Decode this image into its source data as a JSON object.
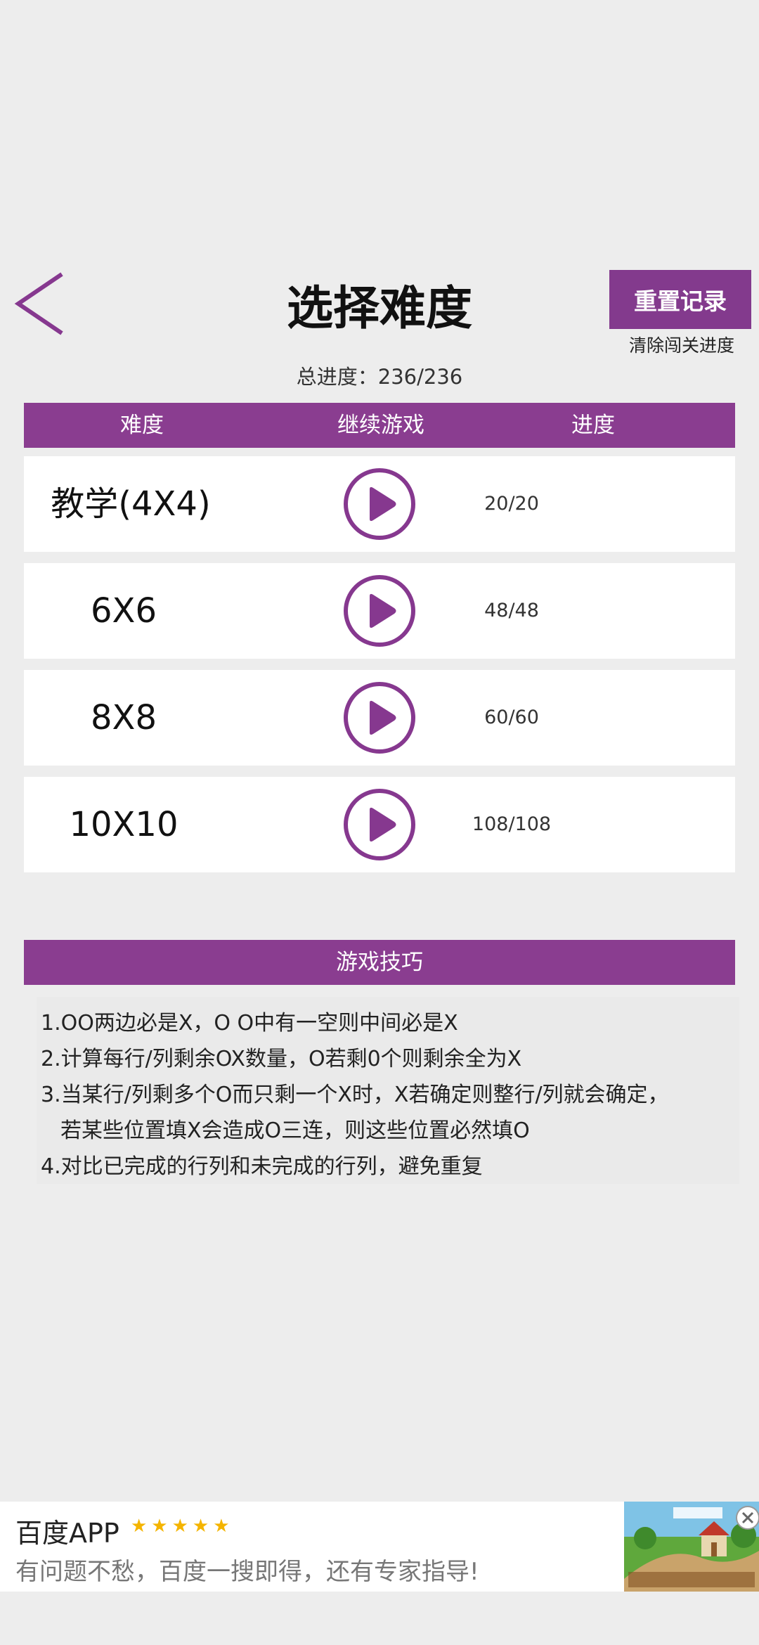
{
  "header": {
    "title": "选择难度",
    "back_icon": "chevron-left-icon",
    "reset_label": "重置记录",
    "reset_hint": "清除闯关进度",
    "total_progress": "总进度：236/236"
  },
  "table": {
    "columns": [
      "难度",
      "继续游戏",
      "进度"
    ],
    "rows": [
      {
        "name": "教学(4X4)",
        "progress": "20/20"
      },
      {
        "name": "6X6",
        "progress": "48/48"
      },
      {
        "name": "8X8",
        "progress": "60/60"
      },
      {
        "name": "10X10",
        "progress": "108/108"
      }
    ]
  },
  "tips": {
    "title": "游戏技巧",
    "lines": [
      "1.OO两边必是X，O O中有一空则中间必是X",
      "2.计算每行/列剩余OX数量，O若剩0个则剩余全为X",
      "3.当某行/列剩多个O而只剩一个X时，X若确定则整行/列就会确定，",
      "若某些位置填X会造成O三连，则这些位置必然填O",
      "4.对比已完成的行列和未完成的行列，避免重复"
    ]
  },
  "ad": {
    "title": "百度APP",
    "stars": "★★★★★",
    "rating": 5,
    "description": "有问题不愁，百度一搜即得，还有专家指导!"
  },
  "colors": {
    "accent": "#8a3d90",
    "background": "#ededed",
    "row_background": "#ffffff"
  }
}
